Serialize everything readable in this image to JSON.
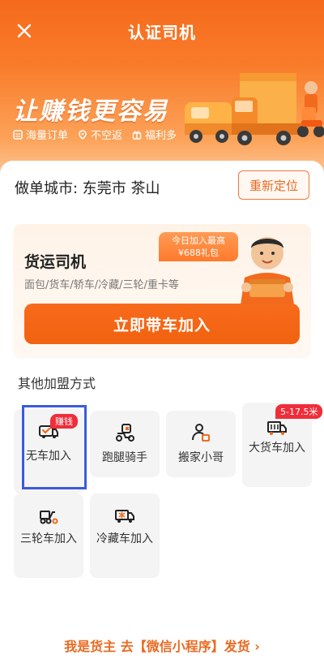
{
  "header": {
    "title": "认证司机"
  },
  "banner": {
    "slogan": "让赚钱更容易",
    "perks": [
      "海量订单",
      "不空返",
      "福利多"
    ]
  },
  "city": {
    "label": "做单城市: 东莞市 茶山",
    "relocate_label": "重新定位"
  },
  "driver_card": {
    "title": "货运司机",
    "subtitle": "面包/货车/轿车/冷藏/三轮/重卡等",
    "bubble_line1": "今日加入最高",
    "bubble_line2": "¥688礼包",
    "join_label": "立即带车加入"
  },
  "other": {
    "title": "其他加盟方式",
    "options": [
      {
        "label": "无车加入",
        "tag": "赚钱",
        "icon": "truck-check-icon",
        "selected": true
      },
      {
        "label": "跑腿骑手",
        "icon": "scooter-icon"
      },
      {
        "label": "搬家小哥",
        "icon": "person-box-icon"
      },
      {
        "label": "大货车加入",
        "tag": "5-17.5米",
        "icon": "big-truck-icon"
      },
      {
        "label": "三轮车加入",
        "icon": "tricycle-icon"
      },
      {
        "label": "冷藏车加入",
        "icon": "refrigerated-truck-icon"
      }
    ]
  },
  "footer": {
    "link_label": "我是货主 去【微信小程序】发货 ›"
  },
  "colors": {
    "brand": "#f56a1c",
    "tag_red": "#f02d3a",
    "selection_blue": "#3b5bdb"
  }
}
